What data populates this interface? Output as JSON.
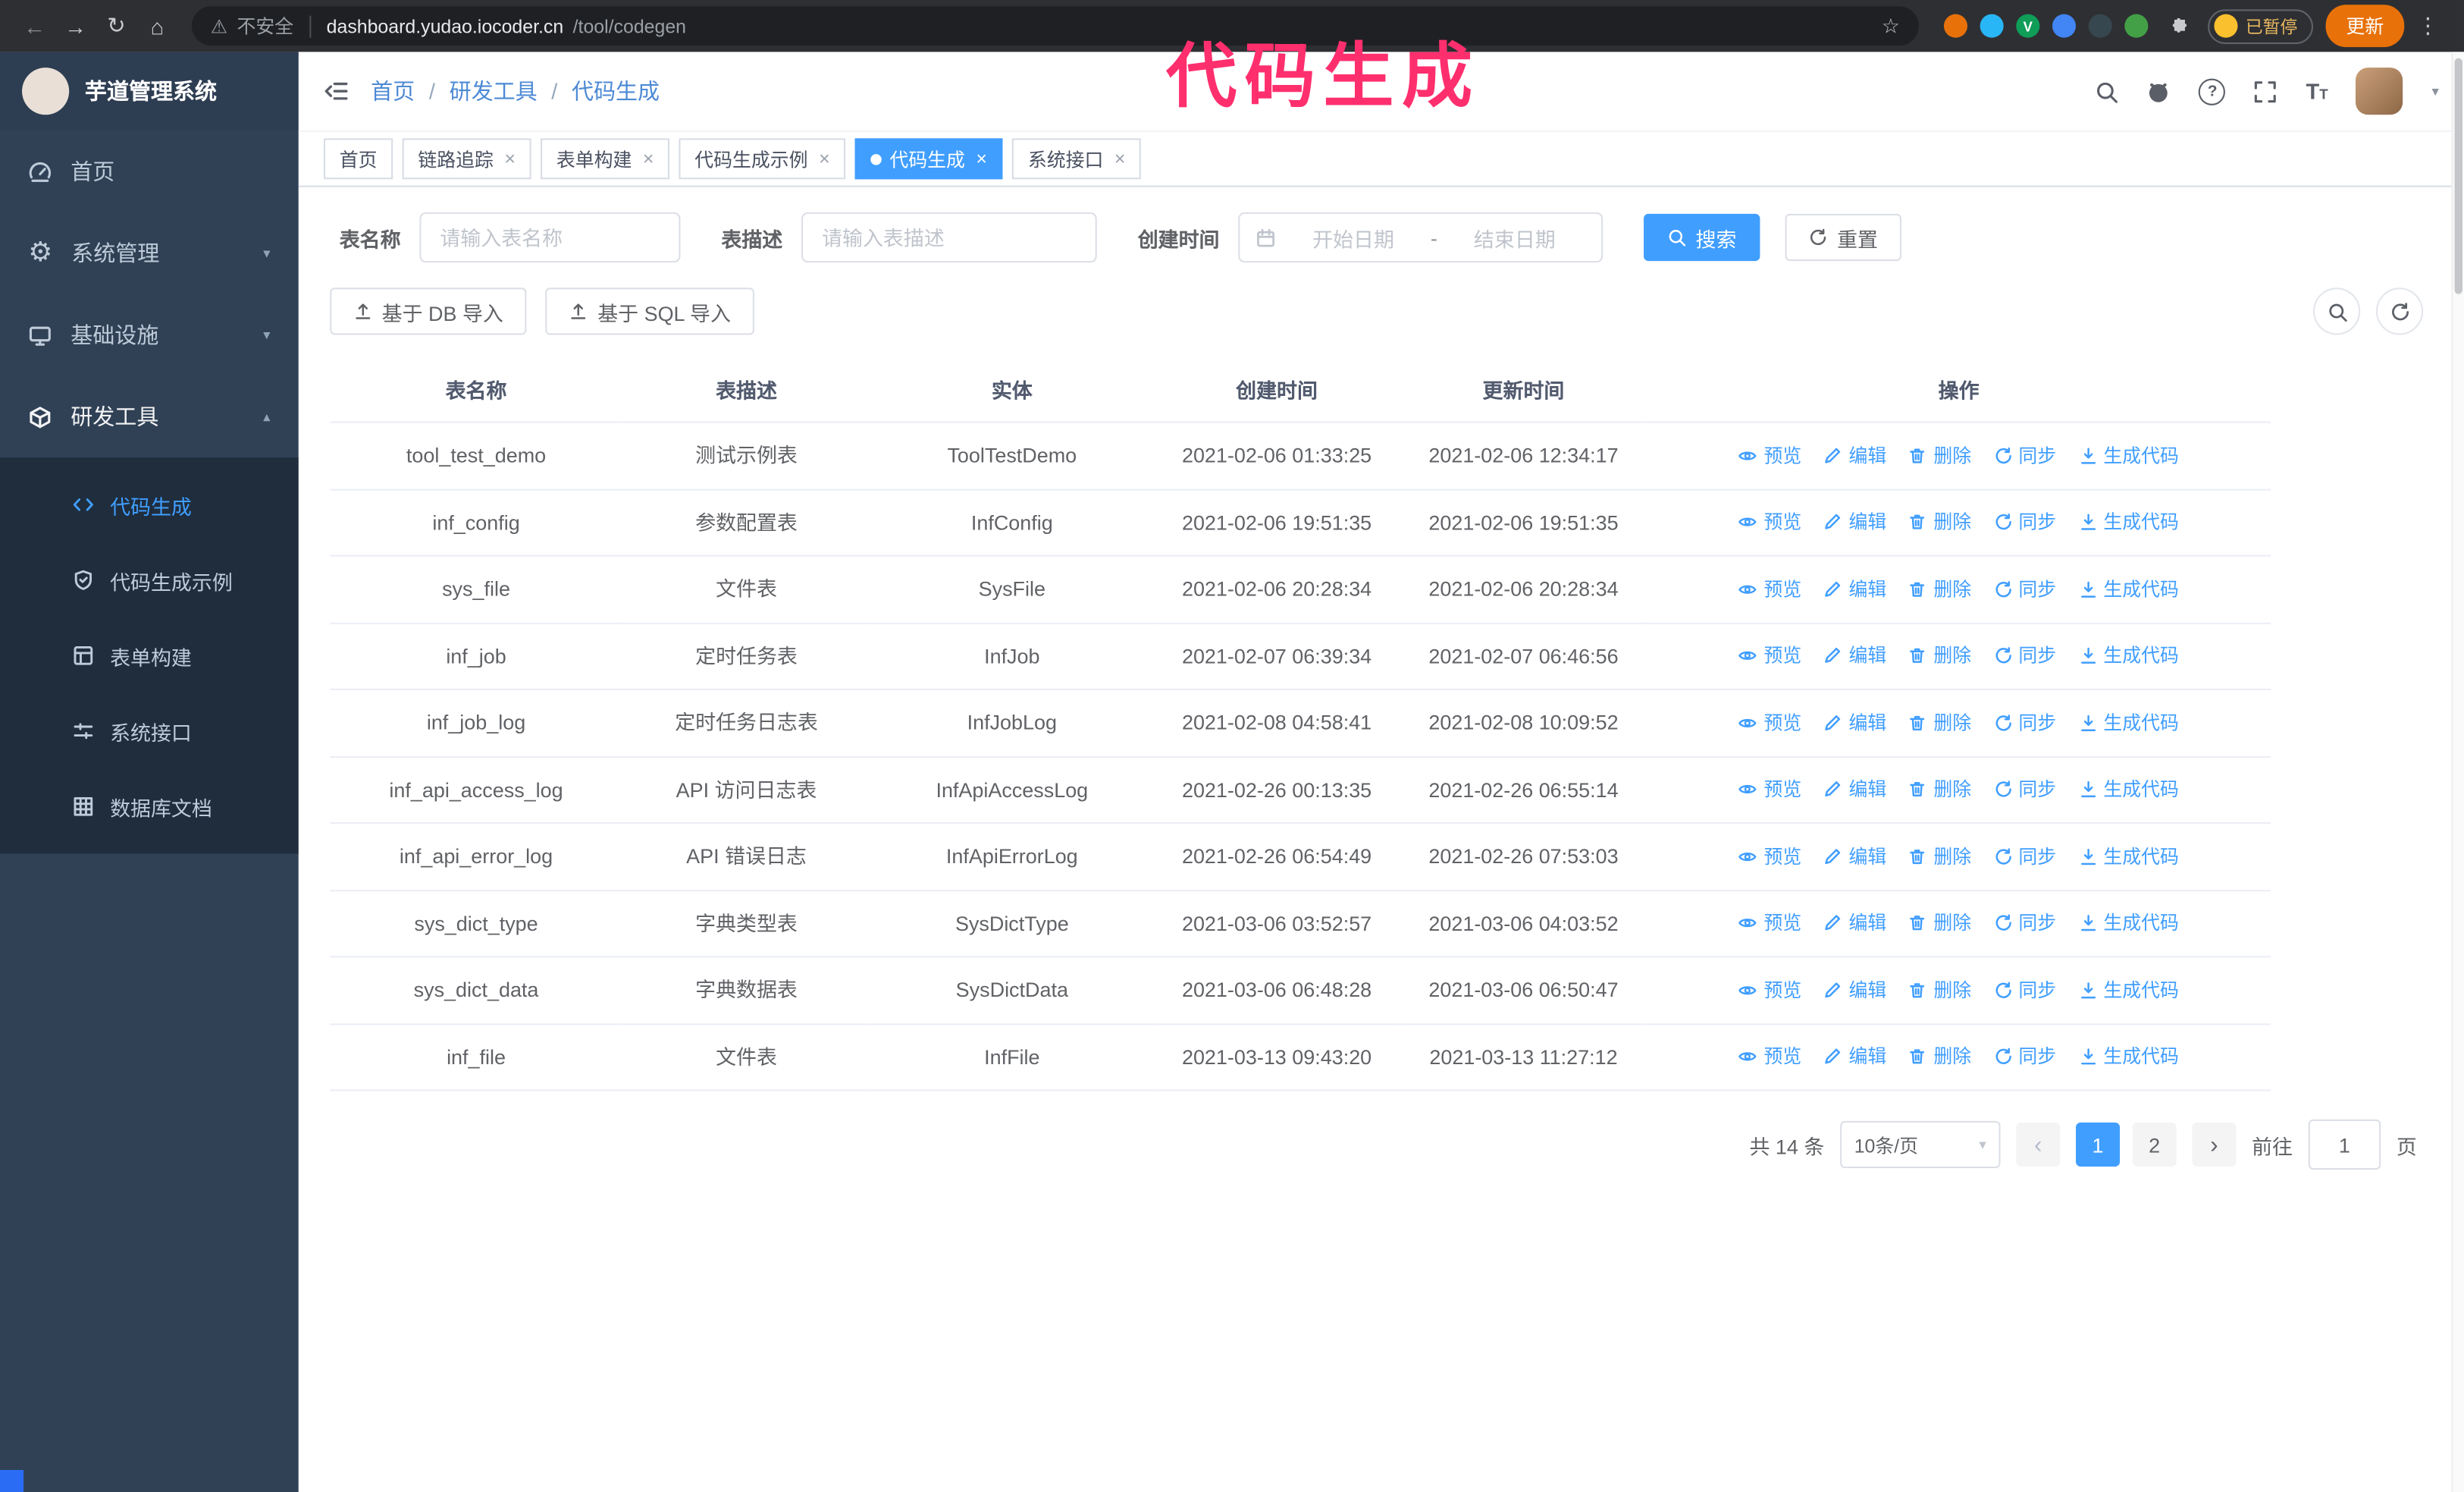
{
  "annotation": {
    "text": "代码生成",
    "color": "#ff2f6e"
  },
  "browser": {
    "security_label": "不安全",
    "url_domain": "dashboard.yudao.iocoder.cn",
    "url_path": "/tool/codegen",
    "profile_badge": "已暂停",
    "update_button": "更新",
    "extensions": [
      {
        "name": "extension-icon",
        "color": "#e8710a"
      },
      {
        "name": "extension-icon",
        "color": "#29b6f6"
      },
      {
        "name": "extension-icon",
        "color": "#0f9d58",
        "glyph": "V"
      },
      {
        "name": "extension-icon",
        "color": "#4285f4"
      },
      {
        "name": "extension-icon",
        "color": "#37474f"
      },
      {
        "name": "extension-icon",
        "color": "#43a047"
      }
    ]
  },
  "sidebar": {
    "app_title": "芋道管理系统",
    "items": [
      {
        "key": "home",
        "label": "首页",
        "icon": "dashboard-icon",
        "type": "item",
        "expanded": false
      },
      {
        "key": "system",
        "label": "系统管理",
        "icon": "gear-icon",
        "type": "group",
        "expanded": false
      },
      {
        "key": "infra",
        "label": "基础设施",
        "icon": "monitor-icon",
        "type": "group",
        "expanded": false
      },
      {
        "key": "devtools",
        "label": "研发工具",
        "icon": "toolbox-icon",
        "type": "group",
        "expanded": true
      }
    ],
    "devtools_children": [
      {
        "key": "codegen",
        "label": "代码生成",
        "icon": "code-icon",
        "active": true
      },
      {
        "key": "codegen-example",
        "label": "代码生成示例",
        "icon": "shield-icon",
        "active": false
      },
      {
        "key": "form-builder",
        "label": "表单构建",
        "icon": "form-icon",
        "active": false
      },
      {
        "key": "system-api",
        "label": "系统接口",
        "icon": "sliders-icon",
        "active": false
      },
      {
        "key": "db-doc",
        "label": "数据库文档",
        "icon": "grid-icon",
        "active": false
      }
    ]
  },
  "header": {
    "breadcrumb": [
      "首页",
      "研发工具",
      "代码生成"
    ],
    "breadcrumb_separator": "/"
  },
  "tabs": [
    {
      "label": "首页",
      "closable": false,
      "active": false
    },
    {
      "label": "链路追踪",
      "closable": true,
      "active": false
    },
    {
      "label": "表单构建",
      "closable": true,
      "active": false
    },
    {
      "label": "代码生成示例",
      "closable": true,
      "active": false
    },
    {
      "label": "代码生成",
      "closable": true,
      "active": true
    },
    {
      "label": "系统接口",
      "closable": true,
      "active": false
    }
  ],
  "filters": {
    "table_name_label": "表名称",
    "table_name_placeholder": "请输入表名称",
    "table_desc_label": "表描述",
    "table_desc_placeholder": "请输入表描述",
    "create_time_label": "创建时间",
    "date_start_placeholder": "开始日期",
    "date_separator": "-",
    "date_end_placeholder": "结束日期",
    "search_button": "搜索",
    "reset_button": "重置"
  },
  "toolbar": {
    "import_db": "基于 DB 导入",
    "import_sql": "基于 SQL 导入"
  },
  "table": {
    "columns": [
      "表名称",
      "表描述",
      "实体",
      "创建时间",
      "更新时间",
      "操作"
    ],
    "ops": [
      {
        "key": "preview",
        "label": "预览",
        "icon": "eye-icon"
      },
      {
        "key": "edit",
        "label": "编辑",
        "icon": "edit-icon"
      },
      {
        "key": "delete",
        "label": "删除",
        "icon": "delete-icon"
      },
      {
        "key": "sync",
        "label": "同步",
        "icon": "sync-icon"
      },
      {
        "key": "generate-code",
        "label": "生成代码",
        "icon": "download-icon"
      }
    ],
    "rows": [
      {
        "name": "tool_test_demo",
        "desc": "测试示例表",
        "entity": "ToolTestDemo",
        "created": "2021-02-06 01:33:25",
        "updated": "2021-02-06 12:34:17"
      },
      {
        "name": "inf_config",
        "desc": "参数配置表",
        "entity": "InfConfig",
        "created": "2021-02-06 19:51:35",
        "updated": "2021-02-06 19:51:35"
      },
      {
        "name": "sys_file",
        "desc": "文件表",
        "entity": "SysFile",
        "created": "2021-02-06 20:28:34",
        "updated": "2021-02-06 20:28:34"
      },
      {
        "name": "inf_job",
        "desc": "定时任务表",
        "entity": "InfJob",
        "created": "2021-02-07 06:39:34",
        "updated": "2021-02-07 06:46:56"
      },
      {
        "name": "inf_job_log",
        "desc": "定时任务日志表",
        "entity": "InfJobLog",
        "created": "2021-02-08 04:58:41",
        "updated": "2021-02-08 10:09:52"
      },
      {
        "name": "inf_api_access_log",
        "desc": "API 访问日志表",
        "entity": "InfApiAccessLog",
        "created": "2021-02-26 00:13:35",
        "updated": "2021-02-26 06:55:14"
      },
      {
        "name": "inf_api_error_log",
        "desc": "API 错误日志",
        "entity": "InfApiErrorLog",
        "created": "2021-02-26 06:54:49",
        "updated": "2021-02-26 07:53:03"
      },
      {
        "name": "sys_dict_type",
        "desc": "字典类型表",
        "entity": "SysDictType",
        "created": "2021-03-06 03:52:57",
        "updated": "2021-03-06 04:03:52"
      },
      {
        "name": "sys_dict_data",
        "desc": "字典数据表",
        "entity": "SysDictData",
        "created": "2021-03-06 06:48:28",
        "updated": "2021-03-06 06:50:47"
      },
      {
        "name": "inf_file",
        "desc": "文件表",
        "entity": "InfFile",
        "created": "2021-03-13 09:43:20",
        "updated": "2021-03-13 11:27:12"
      }
    ]
  },
  "pagination": {
    "total": "共 14 条",
    "page_size": "10条/页",
    "pages": [
      "1",
      "2"
    ],
    "active_page": "1",
    "goto_label": "前往",
    "goto_value": "1",
    "goto_unit": "页"
  },
  "colors": {
    "accent": "#409eff",
    "sidebar_bg": "#304156",
    "submenu_bg": "#1f2d3d",
    "active_tab": "#409eff",
    "annotation": "#ff2f6e",
    "update_button": "#e8710a"
  }
}
